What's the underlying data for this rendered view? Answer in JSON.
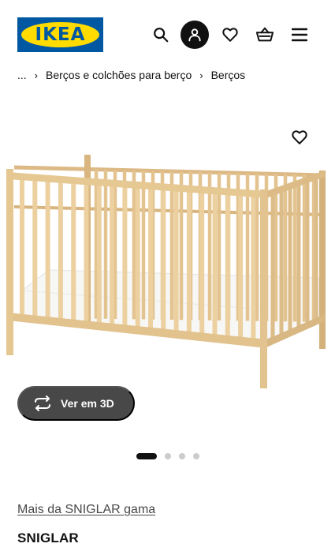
{
  "header": {
    "logo_text": "IKEA",
    "icons": [
      "search-icon",
      "profile-icon",
      "heart-icon",
      "basket-icon",
      "menu-icon"
    ]
  },
  "breadcrumb": {
    "ellipsis": "...",
    "items": [
      "Berços e colchões para berço",
      "Berços"
    ]
  },
  "gallery": {
    "view3d_label": "Ver em 3D",
    "dot_count": 4,
    "active_dot": 1
  },
  "product": {
    "series_link": "Mais da SNIGLAR gama",
    "name": "SNIGLAR"
  },
  "colors": {
    "ikea_blue": "#0058a3",
    "ikea_yellow": "#ffdb00",
    "button_dark": "#484848",
    "wood": "#e7c897"
  }
}
